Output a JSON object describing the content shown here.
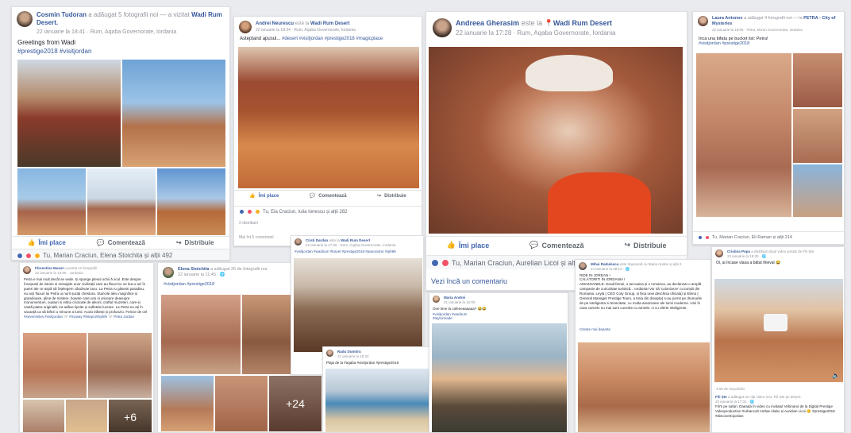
{
  "post1": {
    "author": "Cosmin Tudoran",
    "action": "a adăugat 5 fotografii noi — a vizitat",
    "place": "Wadi Rum Desert.",
    "meta": "22 ianuarie la 18:41 · Rum, Aqaba Governorate, Iordania",
    "text": "Greetings from Wadi",
    "tags": "#prestige2018 #visitjordan",
    "like": "Îmi place",
    "comment": "Comentează",
    "share": "Distribuie",
    "reactions": "Tu, Marian Craciun, Elena Stoichita și alții 492"
  },
  "post2": {
    "author": "Andrei Neurescu",
    "action": "este la",
    "place": "Wadi Rum Desert",
    "meta": "22 ianuarie la 18:34 · Rum, Aqaba Governorate, Iordania",
    "text": "Asteptand apusul...",
    "tags": "#desert #visitjordan #prestige2018 #magicplace",
    "like": "Îmi place",
    "comment": "Comentează",
    "share": "Distribuie",
    "reactions": "Tu, Ela Craciun, Iulia Ionescu și alții 282",
    "shares": "2 distribuiri",
    "more_comments": "Mai înt 6 comentarii"
  },
  "post3": {
    "author": "Andreea Gherasim",
    "action": "este la",
    "place": "Wadi Rum Desert",
    "meta": "22 ianuarie la 17:28 · Rum, Aqaba Governorate, Iordania",
    "like": "Îmi place",
    "comment": "Comentează",
    "share": "Distribuie",
    "reactions": "Tu, Marian Craciun, Aurelian Licoi și alții 327",
    "see_comment": "Vezi încă un comentariu"
  },
  "post4": {
    "author": "Laura Antonov",
    "action": "a adăugat 4 fotografii noi — la",
    "place": "PETRA - City of Mysteries",
    "meta": "22 ianuarie la 19:05 · Petra, Ma'an Governorate, Iordania",
    "text": "Inca una bifata pe bucket list: Petra!",
    "tags": "#visitjordan #prestige2018",
    "reactions": "Tu, Marian Craciun, Eli Raman și alții 214"
  },
  "post5": {
    "author": "Florentina Musat",
    "action": "a postat 10 fotografii.",
    "meta": "22 ianuarie la 13:06 · Jordania",
    "text": "Petra e mai mult decât se vede. Și spunge plesul ochii ă scul. Este despre începutul de istorie si mesajele unor civilizații care au făcut loc se lea-u azi în puteri ale ce aspă să înțelegem cândnute lunu. La Petra ru găsesti paradisu, nu acți fluxuri lui Petra ui nurit șurați chestura. Stancile aleu magnifice și grandioase, pline de mistere, boante care uns si oriceare deasupre monumentum, ouaturi si intitui cruscate de aikorii, craftul muzeteri, care-și caută piatra originală, tot adâse lipsite și sufletele lucrare. La Petra nu ați în vacanță ca să bifezi o minune a lumii. Acolo trăiești și profunzio. Fericie de cel care au sufletul loial de mare încât sa-l vezi Petra de sus... #prestige",
    "tags": "#sevenmiles #visitjordan 🤍 #myway #feteprofinyilife 🤍 Petra Jordan",
    "more_count": "+6"
  },
  "post6": {
    "author": "Elena Stoichita",
    "action": "a adăugat 26 de fotografii noi.",
    "meta": "22 ianuarie la 11:45 · 🌐",
    "tags": "#visitjordan #prestige2018",
    "more_count": "+24"
  },
  "post7": {
    "author": "Cristi Dardan",
    "action": "este la",
    "place": "Wadi Rum Desert",
    "meta": "22 ianuarie la 17:26 · Rum, Aqaba Governorate, Iordania",
    "tags": "#visitjordan #wadirum #travel #prestige2018 #panoramic #iph99"
  },
  "post8": {
    "author": "Radu Dumitru",
    "meta": "21 ianuarie la 18:22",
    "text": "Plaja de la #aqaba #visitjordan #prestige2018"
  },
  "post9": {
    "author": "Maria Andrei",
    "meta": "21 ianuarie la 12:00",
    "text": "One time la cafeneaaaaaa? 😂😂",
    "tags": "#visitjordan #wadirum #taylormade"
  },
  "post10": {
    "author": "Mihai Radulescu",
    "action": "este împreună cu Maria Andrei și alții 2.",
    "meta": "24 ianuarie la 08:13 · 🌐",
    "text_lines": [
      "RIDE IN JORDAN !",
      "CĂLĂTORITI ÎN IORDANIA !",
      "AMAZOANELE. Două femei, o turcoaica și o romanca, au declansat o amplă campanie de curiozitate turistică... Iordania! Vor să 'colonizeze' cu turiștii din Romania. Leyla ( CEO Coty Group, și fiica unei deschisa oficiala) și Elena ( General Manager Prestige Tours, a treia din dreapta) s-au pornit pe drumurile de pe inteligenta si tenacitate, cu multa amazoane ale lumii moderne. Unii în cava carnelo nu mai sunt cucerite cu armele, ci cu oferte inteligente."
    ],
    "see_more": "Citește mai departe"
  },
  "post11": {
    "author": "Cristina Popa",
    "action": "a distribuit clipul video postat de Fili Ște.",
    "meta": "22 ianuarie la 18:30 · 🌐",
    "text": "Oi, ai încase vlaoa a bătut fineval 😂",
    "video_time": "4:06 de vizualizări",
    "sub_author": "Fili Ște",
    "sub_action": "a adăugat un clip video nou: Fili Ște pe deșert.",
    "sub_meta": "20 ianuarie la 17:31 · 🌐",
    "sub_text": "Fili'n pe safari. Daeada în video cu invitatul Vebinarul de la Digital Prestige Videoproduction #urbancult Ambar Alabo și Aurelian Licoi 😊 #prestige2018 #discovetrojordan"
  },
  "colors": {
    "fb_blue": "#4267b2",
    "link": "#365899",
    "bg": "#e9ebee"
  }
}
